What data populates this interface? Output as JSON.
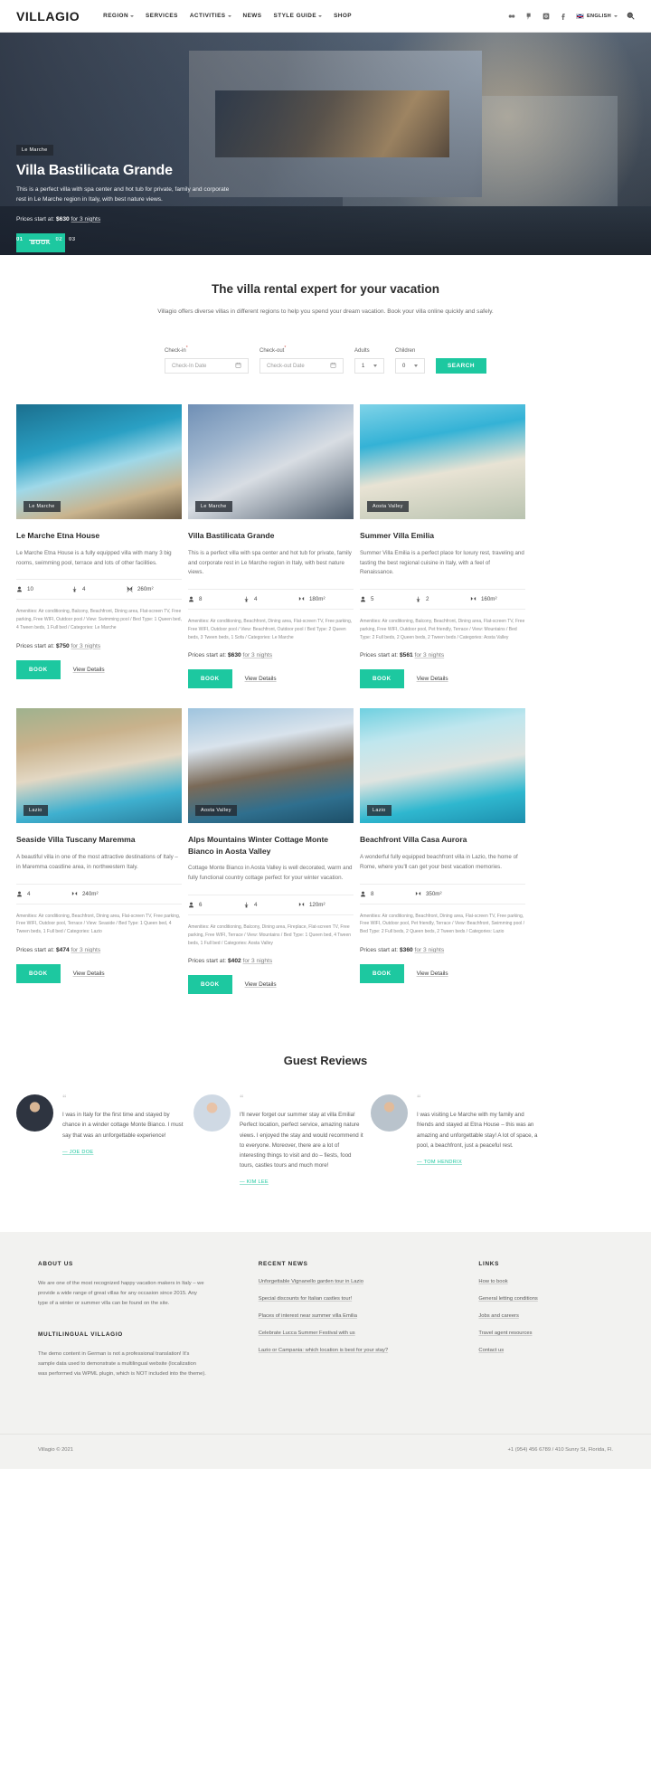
{
  "header": {
    "logo": "VILLAGIO",
    "nav": [
      {
        "label": "REGION",
        "caret": true
      },
      {
        "label": "SERVICES",
        "caret": false
      },
      {
        "label": "ACTIVITIES",
        "caret": true
      },
      {
        "label": "NEWS",
        "caret": false
      },
      {
        "label": "STYLE GUIDE",
        "caret": true
      },
      {
        "label": "SHOP",
        "caret": false
      }
    ],
    "social": [
      "flickr-icon",
      "pinterest-icon",
      "instagram-icon",
      "facebook-icon"
    ],
    "language": "ENGLISH",
    "search_icon": "search-icon"
  },
  "hero": {
    "tag": "Le Marche",
    "title": "Villa Bastilicata Grande",
    "description": "This is a perfect villa with spa center and hot tub for private, family and corporate rest in Le Marche region in Italy, with best nature views.",
    "price_prefix": "Prices start at:",
    "price": "$630",
    "price_suffix": "for 3 nights",
    "book_label": "BOOK",
    "slides": [
      "01",
      "02",
      "03"
    ]
  },
  "search": {
    "title": "The villa rental expert for your vacation",
    "subtitle": "Villagio offers diverse  villas in different regions to help you spend your dream vacation. Book your villa online quickly and safely.",
    "checkin_label": "Check-in",
    "checkin_placeholder": "Check-In Date",
    "checkout_label": "Check-out",
    "checkout_placeholder": "Check-out Date",
    "adults_label": "Adults",
    "adults_value": "1",
    "children_label": "Children",
    "children_value": "0",
    "button": "SEARCH"
  },
  "cards_common": {
    "price_prefix": "Prices start at:",
    "price_suffix": "for 3 nights",
    "book_label": "BOOK",
    "details_label": "View Details"
  },
  "cards": [
    {
      "tag": "Le Marche",
      "title": "Le Marche Etna House",
      "desc": "Le Marche Etna House is a fully equipped villa with many 3 big rooms, swimming pool, terrace and lots of other facilities.",
      "guests": "10",
      "beds": "4",
      "area": "260m²",
      "amenities": "Amenities: Air conditioning, Balcony, Beachfront, Dining area, Flat-screen TV, Free parking, Free WIFI, Outdoor pool  / View: Swimming pool  / Bed Type: 1 Queen bed, 4 Tween beds, 1 Full bed  / Categories: Le Marche",
      "price": "$750"
    },
    {
      "tag": "Le Marche",
      "title": "Villa Bastilicata Grande",
      "desc": "This is a perfect villa with spa center and hot tub for private, family and corporate rest in Le Marche region in Italy, with best nature views.",
      "guests": "8",
      "beds": "4",
      "area": "180m²",
      "amenities": "Amenities: Air conditioning, Beachfront, Dining area, Flat-screen TV, Free parking, Free WIFI, Outdoor pool  / View: Beachfront, Outdoor pool  / Bed Type: 2 Queen beds, 3 Tween beds, 1 Sofa  / Categories: Le Marche",
      "price": "$630"
    },
    {
      "tag": "Aosta Valley",
      "title": "Summer Villa Emilia",
      "desc": "Summer Villa Emilia is a perfect place for luxury rest, traveling and tasting the best regional cuisine in Italy, with a feel of Renaissance.",
      "guests": "5",
      "beds": "2",
      "area": "160m²",
      "amenities": "Amenities: Air conditioning, Balcony, Beachfront, Dining area, Flat-screen TV, Free parking, Free WIFI, Outdoor pool, Pet friendly, Terrace  / View: Mountains  / Bed Type: 2 Full beds, 2 Queen beds, 2 Tween beds  / Categories: Aosta Valley",
      "price": "$561"
    },
    {
      "tag": "Lazio",
      "title": "Seaside Villa Tuscany Maremma",
      "desc": "A beautiful villa in one of the most attractive destinations of Italy – in Maremma coastline area, in northwestern Italy.",
      "guests": "4",
      "beds": "",
      "area": "240m²",
      "amenities": "Amenities: Air conditioning, Beachfront, Dining area, Flat-screen TV, Free parking, Free WIFI, Outdoor pool, Terrace  / View: Seaside  / Bed Type: 1 Queen bed, 4 Tween beds, 1 Full bed  / Categories: Lazio",
      "price": "$474"
    },
    {
      "tag": "Aosta Valley",
      "title": "Alps Mountains Winter Cottage Monte Bianco in Aosta Valley",
      "desc": "Cottage Monte Bianco in Aosta Valley is well decorated, warm and fully functional country cottage perfect for your winter vacation.",
      "guests": "6",
      "beds": "4",
      "area": "120m²",
      "amenities": "Amenities: Air conditioning, Balcony, Dining area, Fireplace, Flat-screen TV, Free parking, Free WIFI, Terrace  / View: Mountains  / Bed Type: 1 Queen bed, 4 Tween beds, 1 Full bed  / Categories: Aosta Valley",
      "price": "$402"
    },
    {
      "tag": "Lazio",
      "title": "Beachfront Villa Casa Aurora",
      "desc": "A wonderful fully equipped beachfront villa in Lazio, the home of Rome, where you'll can get your best vacation memories.",
      "guests": "8",
      "beds": "",
      "area": "350m²",
      "amenities": "Amenities: Air conditioning, Beachfront, Dining area, Flat-screen TV, Free parking, Free WIFI, Outdoor pool, Pet friendly, Terrace  / View: Beachfront, Swimming pool  / Bed Type: 2 Full beds, 2 Queen beds, 2 Tween beds  / Categories: Lazio",
      "price": "$360"
    }
  ],
  "reviews": {
    "title": "Guest Reviews",
    "items": [
      {
        "text": "I was in Italy for the first time and stayed by chance in a winder cottage Monte Bianco. I must say that was an unforgettable experience!",
        "author": "— JOE DOE"
      },
      {
        "text": "I'll never forget our summer stay at villa Emilia! Perfect location, perfect service, amazing nature views. I enjoyed the stay and would recommend it to everyone. Moreover, there are a lot of interesting things to visit and do – fiests, food tours, castles tours and much more!",
        "author": "— KIM LEE"
      },
      {
        "text": "I was visiting Le Marche with my family and friends and stayed at  Etna House – this was an amazing and unforgettable stay! A lot of space, a pool, a beachfront, just a peaceful rest.",
        "author": "— TOM HENDRIX"
      }
    ]
  },
  "footer": {
    "about_head": "ABOUT US",
    "about_body": "We are one of the most recognized happy vacation makers in Italy – we provide a wide range of great villas for any occasion since 2015. Any type of a winter or summer villa can be found on the site.",
    "multi_head": "MULTILINGUAL VILLAGIO",
    "multi_body": "The demo content in German is not a professional translation! It's sample data used to demonstrate a multilingual website (localization was performed via WPML plugin, which is NOT included into the theme).",
    "news_head": "RECENT NEWS",
    "news": [
      "Unforgettable Vignanello garden tour in Lazio",
      "Special discounts for Italian castles tour!",
      "Places of interest near summer villa Emilia",
      "Celebrate Lucca Summer Festival with us",
      "Lazio or Campania: which location is best for your stay?"
    ],
    "links_head": "LINKS",
    "links": [
      "How to book",
      "General letting conditions",
      "Jobs and careers",
      "Travel agent resources",
      "Contact us"
    ],
    "copyright": "Villagio © 2021",
    "contact": "+1 (954) 456 6789  /  410 Sunry St, Florida, Fl."
  }
}
